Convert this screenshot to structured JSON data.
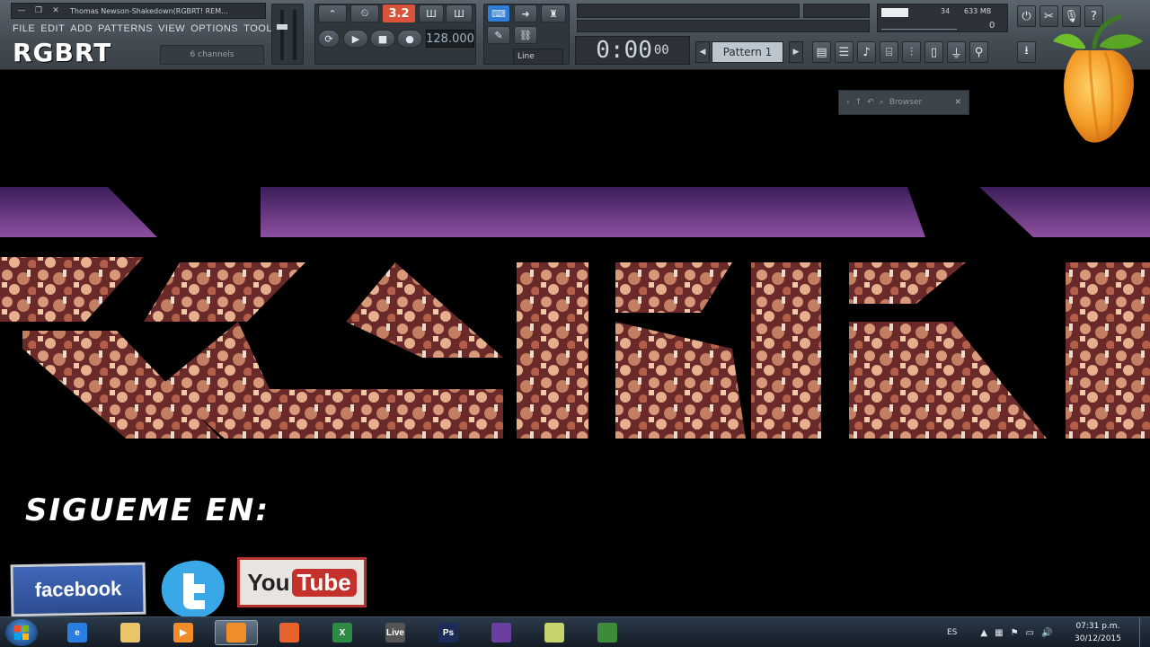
{
  "window": {
    "title": "Thomas Newson-Shakedown(RGBRT! REM...",
    "minimize_icon": "minimize-icon",
    "restore_icon": "restore-icon",
    "close_icon": "close-icon"
  },
  "menu": {
    "items": [
      "FILE",
      "EDIT",
      "ADD",
      "PATTERNS",
      "VIEW",
      "OPTIONS",
      "TOOLS",
      "?"
    ]
  },
  "overlay_logo_small": "RGBRT",
  "channels_label": "6 channels",
  "transport": {
    "pattern_number": "3.2",
    "tempo": "128.000",
    "time": "0:00",
    "time_fraction": "00",
    "snap": "Line",
    "pattern_name": "Pattern 1"
  },
  "cpu": {
    "value_1": "34",
    "value_2": "633 MB",
    "value_3": "0"
  },
  "browser_tab": {
    "label": "Browser"
  },
  "big_logo": "RGBRT",
  "social": {
    "follow_text": "SIGUEME EN:",
    "facebook_label": "facebook",
    "youtube_you": "You",
    "youtube_tube": "Tube"
  },
  "taskbar": {
    "apps": [
      {
        "name": "internet-explorer",
        "label": "e",
        "color": "#2a7de1"
      },
      {
        "name": "file-explorer",
        "label": "",
        "color": "#e9c46a"
      },
      {
        "name": "media-player",
        "label": "▶",
        "color": "#f08c2a"
      },
      {
        "name": "fl-studio",
        "label": "",
        "color": "#f08c2a"
      },
      {
        "name": "firefox",
        "label": "",
        "color": "#e8632b"
      },
      {
        "name": "excel",
        "label": "X",
        "color": "#2e8b46"
      },
      {
        "name": "ableton-live",
        "label": "Live",
        "color": "#555"
      },
      {
        "name": "photoshop",
        "label": "Ps",
        "color": "#1b2b5a"
      },
      {
        "name": "visual-studio",
        "label": "",
        "color": "#6b3fa0"
      },
      {
        "name": "sticky-notes",
        "label": "",
        "color": "#c6d36d"
      },
      {
        "name": "camtasia",
        "label": "",
        "color": "#3c8c3c"
      }
    ],
    "language": "ES",
    "time": "07:31 p.m.",
    "date": "30/12/2015"
  }
}
